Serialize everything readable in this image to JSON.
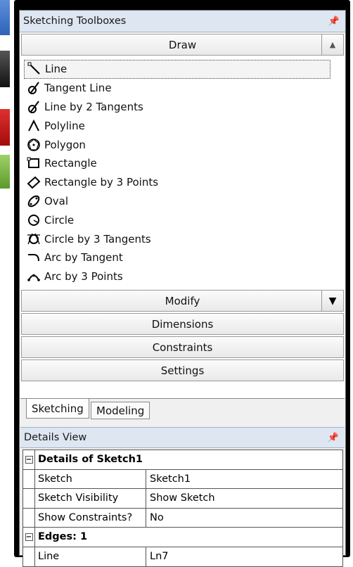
{
  "toolbox": {
    "title": "Sketching Toolboxes",
    "sections": {
      "draw": "Draw",
      "modify": "Modify",
      "dimensions": "Dimensions",
      "constraints": "Constraints",
      "settings": "Settings"
    },
    "draw_tools": [
      {
        "label": "Line",
        "icon": "line-icon"
      },
      {
        "label": "Tangent Line",
        "icon": "tangent-line-icon"
      },
      {
        "label": "Line by 2 Tangents",
        "icon": "line-by-2-tangents-icon"
      },
      {
        "label": "Polyline",
        "icon": "polyline-icon"
      },
      {
        "label": "Polygon",
        "icon": "polygon-icon"
      },
      {
        "label": "Rectangle",
        "icon": "rectangle-icon"
      },
      {
        "label": "Rectangle by 3 Points",
        "icon": "rectangle-3-points-icon"
      },
      {
        "label": "Oval",
        "icon": "oval-icon"
      },
      {
        "label": "Circle",
        "icon": "circle-icon"
      },
      {
        "label": "Circle by 3 Tangents",
        "icon": "circle-3-tangents-icon"
      },
      {
        "label": "Arc by Tangent",
        "icon": "arc-by-tangent-icon"
      },
      {
        "label": "Arc by 3 Points",
        "icon": "arc-3-points-icon"
      }
    ],
    "tabs": [
      "Sketching",
      "Modeling"
    ]
  },
  "details": {
    "title": "Details View",
    "group1": "Details of Sketch1",
    "rows": [
      {
        "key": "Sketch",
        "value": "Sketch1"
      },
      {
        "key": "Sketch Visibility",
        "value": "Show Sketch"
      },
      {
        "key": "Show Constraints?",
        "value": "No"
      }
    ],
    "group2": "Edges: 1",
    "edge_row": {
      "key": "Line",
      "value": "Ln7"
    }
  }
}
